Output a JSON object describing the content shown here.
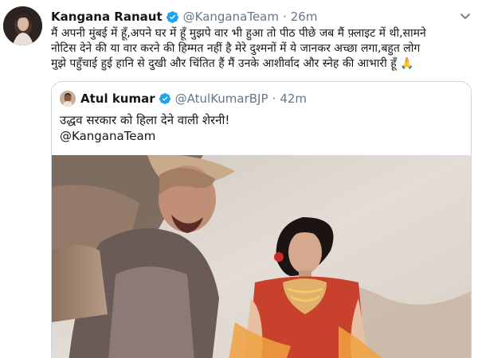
{
  "tweet": {
    "author_name": "Kangana Ranaut",
    "author_handle": "@KanganaTeam",
    "separator": "·",
    "timestamp": "26m",
    "text_lines": [
      "मैं अपनी मुंबई में हूँ,अपने घर में हूँ मुझपे वार भी हुआ तो पीठ पीछे जब मैं फ़्लाइट में थी,सामने",
      "नोटिस देने की या वार करने की हिम्मत नहीं है मेरे दुश्मनों में ये जानकर अच्छा लगा,बहुत लोग",
      "मुझे पहुँचाई हुई हानि से दुखी और चिंतित हैं मैं उनके आशीर्वाद और स्नेह की आभारी हूँ 🙏"
    ]
  },
  "quoted_tweet": {
    "author_name": "Atul kumar",
    "author_handle": "@AtulKumarBJP",
    "separator": "·",
    "timestamp": "42m",
    "text_lines": [
      "उद्धव सरकार को हिला देने वाली शेरनी!",
      "@KanganaTeam"
    ]
  },
  "icons": {
    "verified": "verified-badge-icon",
    "more": "chevron-down-icon"
  },
  "colors": {
    "verified_blue": "#1da1f2",
    "text_primary": "#14171a",
    "text_secondary": "#657786",
    "card_border": "#ccd6dd"
  }
}
